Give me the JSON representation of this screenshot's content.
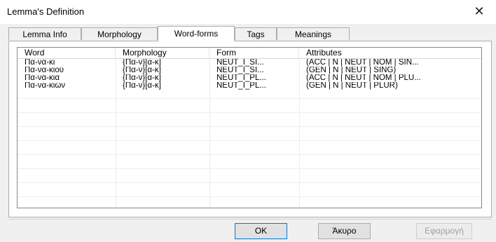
{
  "window": {
    "title": "Lemma's Definition",
    "close_glyph": "✕"
  },
  "tabs": [
    {
      "label": "Lemma Info"
    },
    {
      "label": "Morphology"
    },
    {
      "label": "Word-forms"
    },
    {
      "label": "Tags"
    },
    {
      "label": "Meanings"
    }
  ],
  "active_tab": "Word-forms",
  "table": {
    "columns": [
      "Word",
      "Morphology",
      "Form",
      "Attributes"
    ],
    "rows": [
      {
        "word": "Πα-νά-κι",
        "morphology": "{Πα-ν}[α-κ]",
        "form": "NEUT_I_SI...",
        "attributes": "(ACC | N | NEUT | NOM | SIN..."
      },
      {
        "word": "Πα-να-κιού",
        "morphology": "{Πα-ν}[α-κ]",
        "form": "NEUT_I_SI...",
        "attributes": "(GEN | N | NEUT | SING)"
      },
      {
        "word": "Πα-νά-κια",
        "morphology": "{Πα-ν}[α-κ]",
        "form": "NEUT_I_PL...",
        "attributes": "(ACC | N | NEUT | NOM | PLU..."
      },
      {
        "word": "Πα-να-κιών",
        "morphology": "{Πα-ν}[α-κ]",
        "form": "NEUT_I_PL...",
        "attributes": "(GEN | N | NEUT | PLUR)"
      }
    ]
  },
  "buttons": {
    "ok": "OK",
    "cancel": "Άκυρο",
    "apply": "Εφαρμογή"
  }
}
